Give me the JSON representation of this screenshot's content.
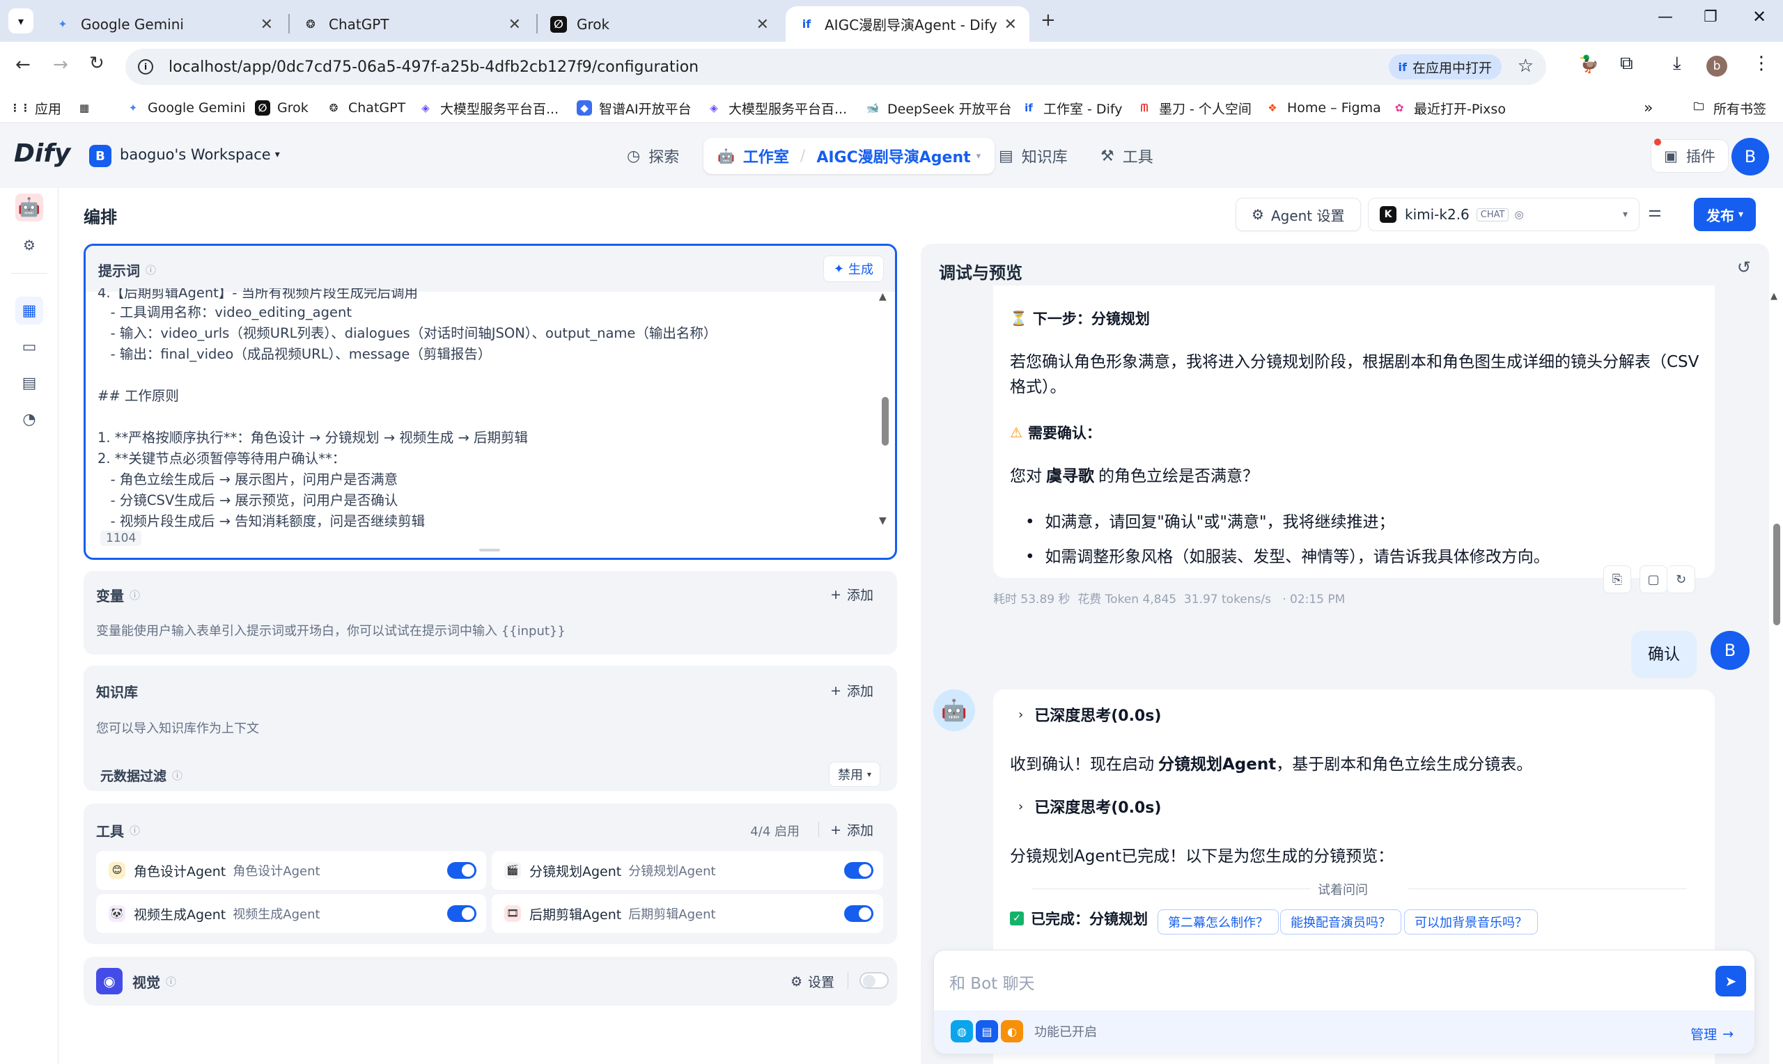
{
  "browser": {
    "tabs": [
      {
        "title": "Google Gemini",
        "icon": "gemini-icon"
      },
      {
        "title": "ChatGPT",
        "icon": "chatgpt-icon"
      },
      {
        "title": "Grok",
        "icon": "grok-icon"
      },
      {
        "title": "AIGC漫剧导演Agent - Dify",
        "icon": "dify-icon",
        "active": true
      }
    ],
    "url": "localhost/app/0dc7cd75-06a5-497f-a25b-4dfb2cb127f9/configuration",
    "open_in_app": "在应用中打开",
    "profile_initial": "b",
    "bookmarks": [
      {
        "label": "应用",
        "icon": "apps-grid-icon"
      },
      {
        "label": "Google Gemini",
        "icon": "gemini-icon"
      },
      {
        "label": "Grok",
        "icon": "grok-icon"
      },
      {
        "label": "ChatGPT",
        "icon": "chatgpt-icon"
      },
      {
        "label": "大模型服务平台百...",
        "icon": "baidu-cloud-icon"
      },
      {
        "label": "智谱AI开放平台",
        "icon": "zhipu-icon"
      },
      {
        "label": "大模型服务平台百...",
        "icon": "baidu-cloud-icon"
      },
      {
        "label": "DeepSeek 开放平台",
        "icon": "deepseek-icon"
      },
      {
        "label": "工作室 - Dify",
        "icon": "dify-icon"
      },
      {
        "label": "墨刀 - 个人空间",
        "icon": "modao-icon"
      },
      {
        "label": "Home – Figma",
        "icon": "figma-icon"
      },
      {
        "label": "最近打开-Pixso",
        "icon": "pixso-icon"
      }
    ],
    "all_bookmarks": "所有书签"
  },
  "app": {
    "logo": "Dify",
    "workspace_initial": "B",
    "workspace": "baoguo's Workspace",
    "nav": {
      "explore": "探索",
      "studio": "工作室",
      "app_name": "AIGC漫剧导演Agent",
      "knowledge": "知识库",
      "tools": "工具"
    },
    "plugins": "插件",
    "user_initial": "B"
  },
  "config": {
    "title": "编排",
    "agent_settings": "Agent 设置",
    "model": "kimi-k2.6",
    "model_badge": "CHAT",
    "publish": "发布",
    "prompt": {
      "label": "提示词",
      "generate": "生成",
      "lines": [
        "4.【后期剪辑Agent】- 当所有视频片段生成完后调用",
        "   - 工具调用名称：video_editing_agent",
        "   - 输入：video_urls（视频URL列表）、dialogues（对话时间轴JSON）、output_name（输出名称）",
        "   - 输出：final_video（成品视频URL）、message（剪辑报告）",
        "",
        "## 工作原则",
        "",
        "1. **严格按顺序执行**：角色设计 → 分镜规划 → 视频生成 → 后期剪辑",
        "2. **关键节点必须暂停等待用户确认**：",
        "   - 角色立绘生成后 → 展示图片，问用户是否满意",
        "   - 分镜CSV生成后 → 展示预览，问用户是否确认",
        "   - 视频片段生成后 → 告知消耗额度，问是否继续剪辑"
      ],
      "char_count": "1104"
    },
    "variables": {
      "label": "变量",
      "add": "添加",
      "desc": "变量能使用户输入表单引入提示词或开场白，你可以试试在提示词中输入 {{input}}"
    },
    "knowledge": {
      "label": "知识库",
      "add": "添加",
      "desc": "您可以导入知识库作为上下文",
      "metadata_filter": "元数据过滤",
      "filter_value": "禁用"
    },
    "tools": {
      "label": "工具",
      "enabled_count": "4/4 启用",
      "add": "添加",
      "items": [
        {
          "name": "角色设计Agent",
          "sub": "角色设计Agent",
          "enabled": true,
          "color": "#f79009"
        },
        {
          "name": "分镜规划Agent",
          "sub": "分镜规划Agent",
          "enabled": true,
          "color": "#667085"
        },
        {
          "name": "视频生成Agent",
          "sub": "视频生成Agent",
          "enabled": true,
          "color": "#9e77ed"
        },
        {
          "name": "后期剪辑Agent",
          "sub": "后期剪辑Agent",
          "enabled": true,
          "color": "#e04f5f"
        }
      ]
    },
    "vision": {
      "label": "视觉",
      "settings": "设置",
      "enabled": false
    }
  },
  "debug": {
    "title": "调试与预览",
    "messages": {
      "next_step_title": "下一步：分镜规划",
      "next_step_body": "若您确认角色形象满意，我将进入分镜规划阶段，根据剧本和角色图生成详细的镜头分解表（CSV格式）。",
      "confirm_title": "需要确认：",
      "question_prefix": "您对",
      "question_name": "虞寻歌",
      "question_suffix": "的角色立绘是否满意？",
      "bullet1": "如满意，请回复\"确认\"或\"满意\"，我将继续推进；",
      "bullet2": "如需调整形象风格（如服装、发型、神情等），请告诉我具体修改方向。",
      "meta": "耗时 53.89 秒  花费 Token 4,845  31.97 tokens/s   · 02:15 PM",
      "user_msg": "确认",
      "thinking1": "已深度思考(0.0s)",
      "reply_prefix": "收到确认！现在启动",
      "reply_bold": "分镜规划Agent",
      "reply_suffix": "，基于剧本和角色立绘生成分镜表。",
      "thinking2": "已深度思考(0.0s)",
      "done_line": "分镜规划Agent已完成！以下是为您生成的分镜预览：",
      "completed": "已完成：分镜规划"
    },
    "suggest_label": "试着问问",
    "suggestions": [
      "第二幕怎么制作？",
      "能换配音演员吗？",
      "可以加背景音乐吗？"
    ],
    "input_placeholder": "和 Bot 聊天",
    "features_enabled": "功能已开启",
    "manage": "管理"
  }
}
